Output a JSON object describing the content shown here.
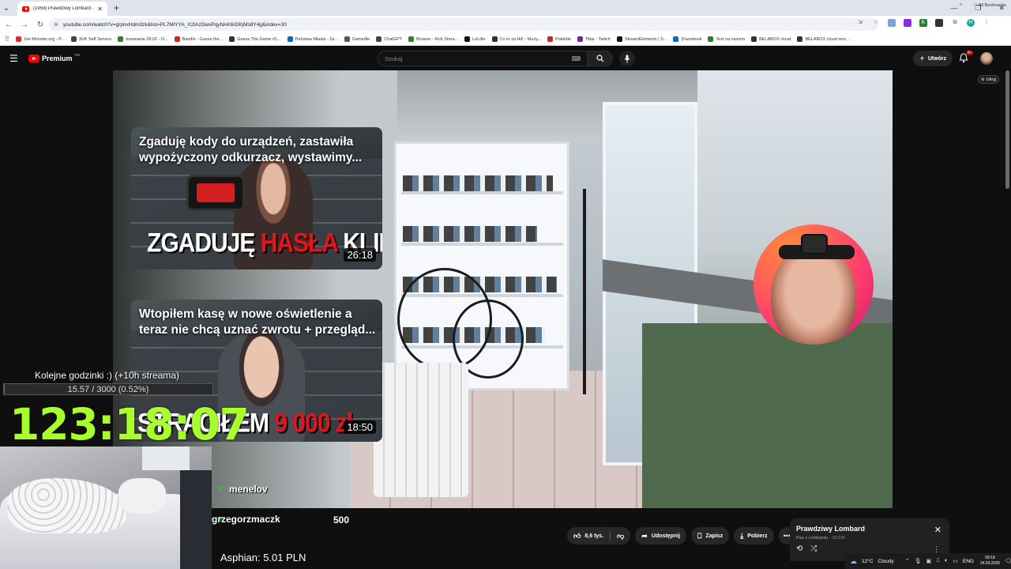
{
  "browser": {
    "tab_title": "(1959) Prawdziwy Lombard - C",
    "url": "youtube.com/watch?v=grpnxHdm3zk&list=PL7MiYYA_X2tAzDwvPqyNAK6rDKjMs8Y4g&index=30",
    "bookmarks": [
      {
        "label": "Joe Monster.org - P...",
        "color": "#d32f2f"
      },
      {
        "label": "3UK Self Service",
        "color": "#444444"
      },
      {
        "label": "losowanie 28.02 - D...",
        "color": "#2e7d32"
      },
      {
        "label": "Bandle - Guess the...",
        "color": "#c62828"
      },
      {
        "label": "Guess The.Game #1...",
        "color": "#333333"
      },
      {
        "label": "Państwa Miasta - Gr...",
        "color": "#1565c0"
      },
      {
        "label": "Gamedle",
        "color": "#555555"
      },
      {
        "label": "ChatGPT",
        "color": "#444444"
      },
      {
        "label": "Browse - Kick Strea...",
        "color": "#2e7d32"
      },
      {
        "label": "LoLdle",
        "color": "#111111"
      },
      {
        "label": "Co to za Hit! - Muzy...",
        "color": "#333333"
      },
      {
        "label": "Pokédle",
        "color": "#c62828"
      },
      {
        "label": "Tibia - Twitch",
        "color": "#7b1fa2"
      },
      {
        "label": "StreamElements | S...",
        "color": "#111111"
      },
      {
        "label": "(Facebook",
        "color": "#1565c0"
      },
      {
        "label": "Test na nazizm",
        "color": "#2e7d32"
      },
      {
        "label": "BELABOX cloud",
        "color": "#333333"
      },
      {
        "label": "BELABOX cloud rem...",
        "color": "#333333"
      }
    ],
    "all_bookmarks": "All Bookmarks",
    "chevron": "»"
  },
  "youtube": {
    "logo_text": "Premium",
    "logo_sup": "GB",
    "search_placeholder": "Szukaj",
    "create_label": "Utwórz",
    "notif_badge": "9+",
    "hide_chip": "Ukryj"
  },
  "cards": [
    {
      "title": "Zgaduję kody do urządzeń, zastawiła wypożyczony odkurzacz, wystawimy...",
      "thumb_text_1": "ZGADUJĘ ",
      "thumb_text_red": "HASŁA",
      "thumb_text_2": " KLIENTÓW",
      "duration": "26:18"
    },
    {
      "title": "Wtopiłem kasę w nowe oświetlenie a teraz nie chcą uznać zwrotu + przegląd...",
      "thumb_text_1": "STRACIŁEM ",
      "thumb_text_red": "9 000 zł",
      "thumb_text_2": "",
      "duration": "18:50"
    }
  ],
  "stream_overlay": {
    "subtitle": "Kolejne godzinki :) (+10h streama)",
    "progress_label": "15.57 / 3000 (0.52%)",
    "progress_fraction": 0.0052,
    "timer": "123:18:07",
    "chat": [
      {
        "name": "menelov",
        "amount": ""
      },
      {
        "name": "grzegorzmaczk",
        "amount": "500"
      }
    ],
    "donation": "Asphian: 5.01 PLN"
  },
  "actions": {
    "likes": "8,6 tys.",
    "share": "Udostępnij",
    "save": "Zapisz",
    "download": "Pobierz"
  },
  "playlist": {
    "title": "Prawdziwy Lombard",
    "channel": "Pan z Lombardu",
    "position": "30/335"
  },
  "tray": {
    "weather_temp": "12°C",
    "weather_text": "Cloudy",
    "lang": "ENG",
    "time": "09:18",
    "date": "24.03.2026"
  }
}
